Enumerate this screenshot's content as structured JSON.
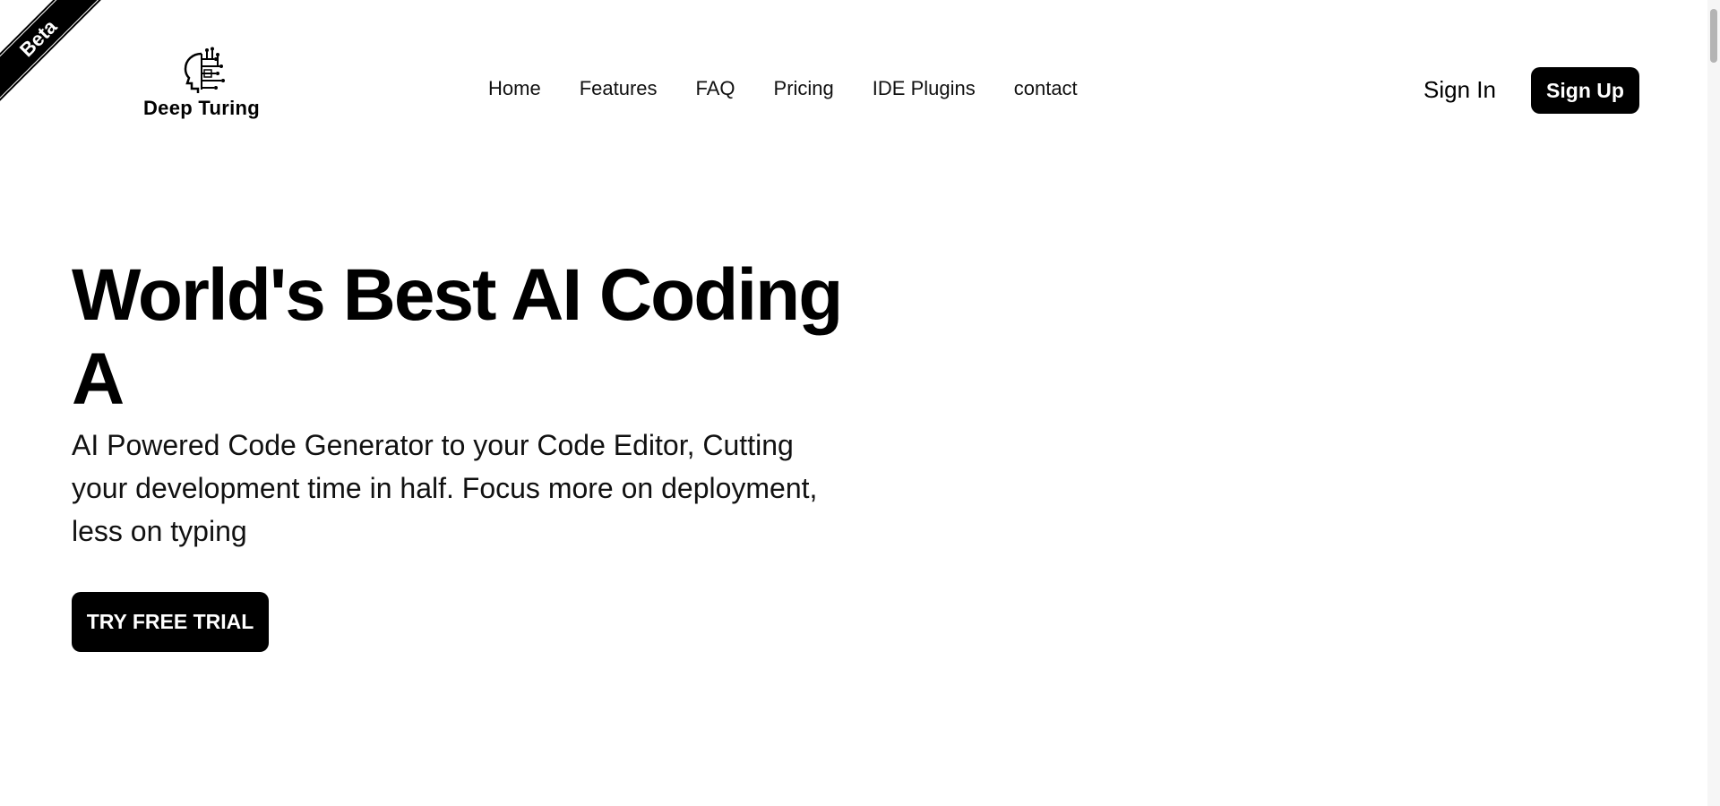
{
  "ribbon": {
    "label": "Beta"
  },
  "brand": {
    "name": "Deep Turing"
  },
  "nav": {
    "items": [
      {
        "label": "Home"
      },
      {
        "label": "Features"
      },
      {
        "label": "FAQ"
      },
      {
        "label": "Pricing"
      },
      {
        "label": "IDE Plugins"
      },
      {
        "label": "contact"
      }
    ]
  },
  "auth": {
    "sign_in_label": "Sign In",
    "sign_up_label": "Sign Up"
  },
  "hero": {
    "title_line1": "World's Best AI Coding",
    "title_line2": "A",
    "subtitle": "AI Powered Code Generator to your Code Editor, Cutting your development time in half. Focus more on deployment, less on typing",
    "cta_label": "TRY FREE TRIAL"
  },
  "icons": {
    "logo": "robot-head-circuit-icon"
  },
  "colors": {
    "primary": "#000000",
    "background": "#ffffff",
    "button_text": "#ffffff"
  }
}
